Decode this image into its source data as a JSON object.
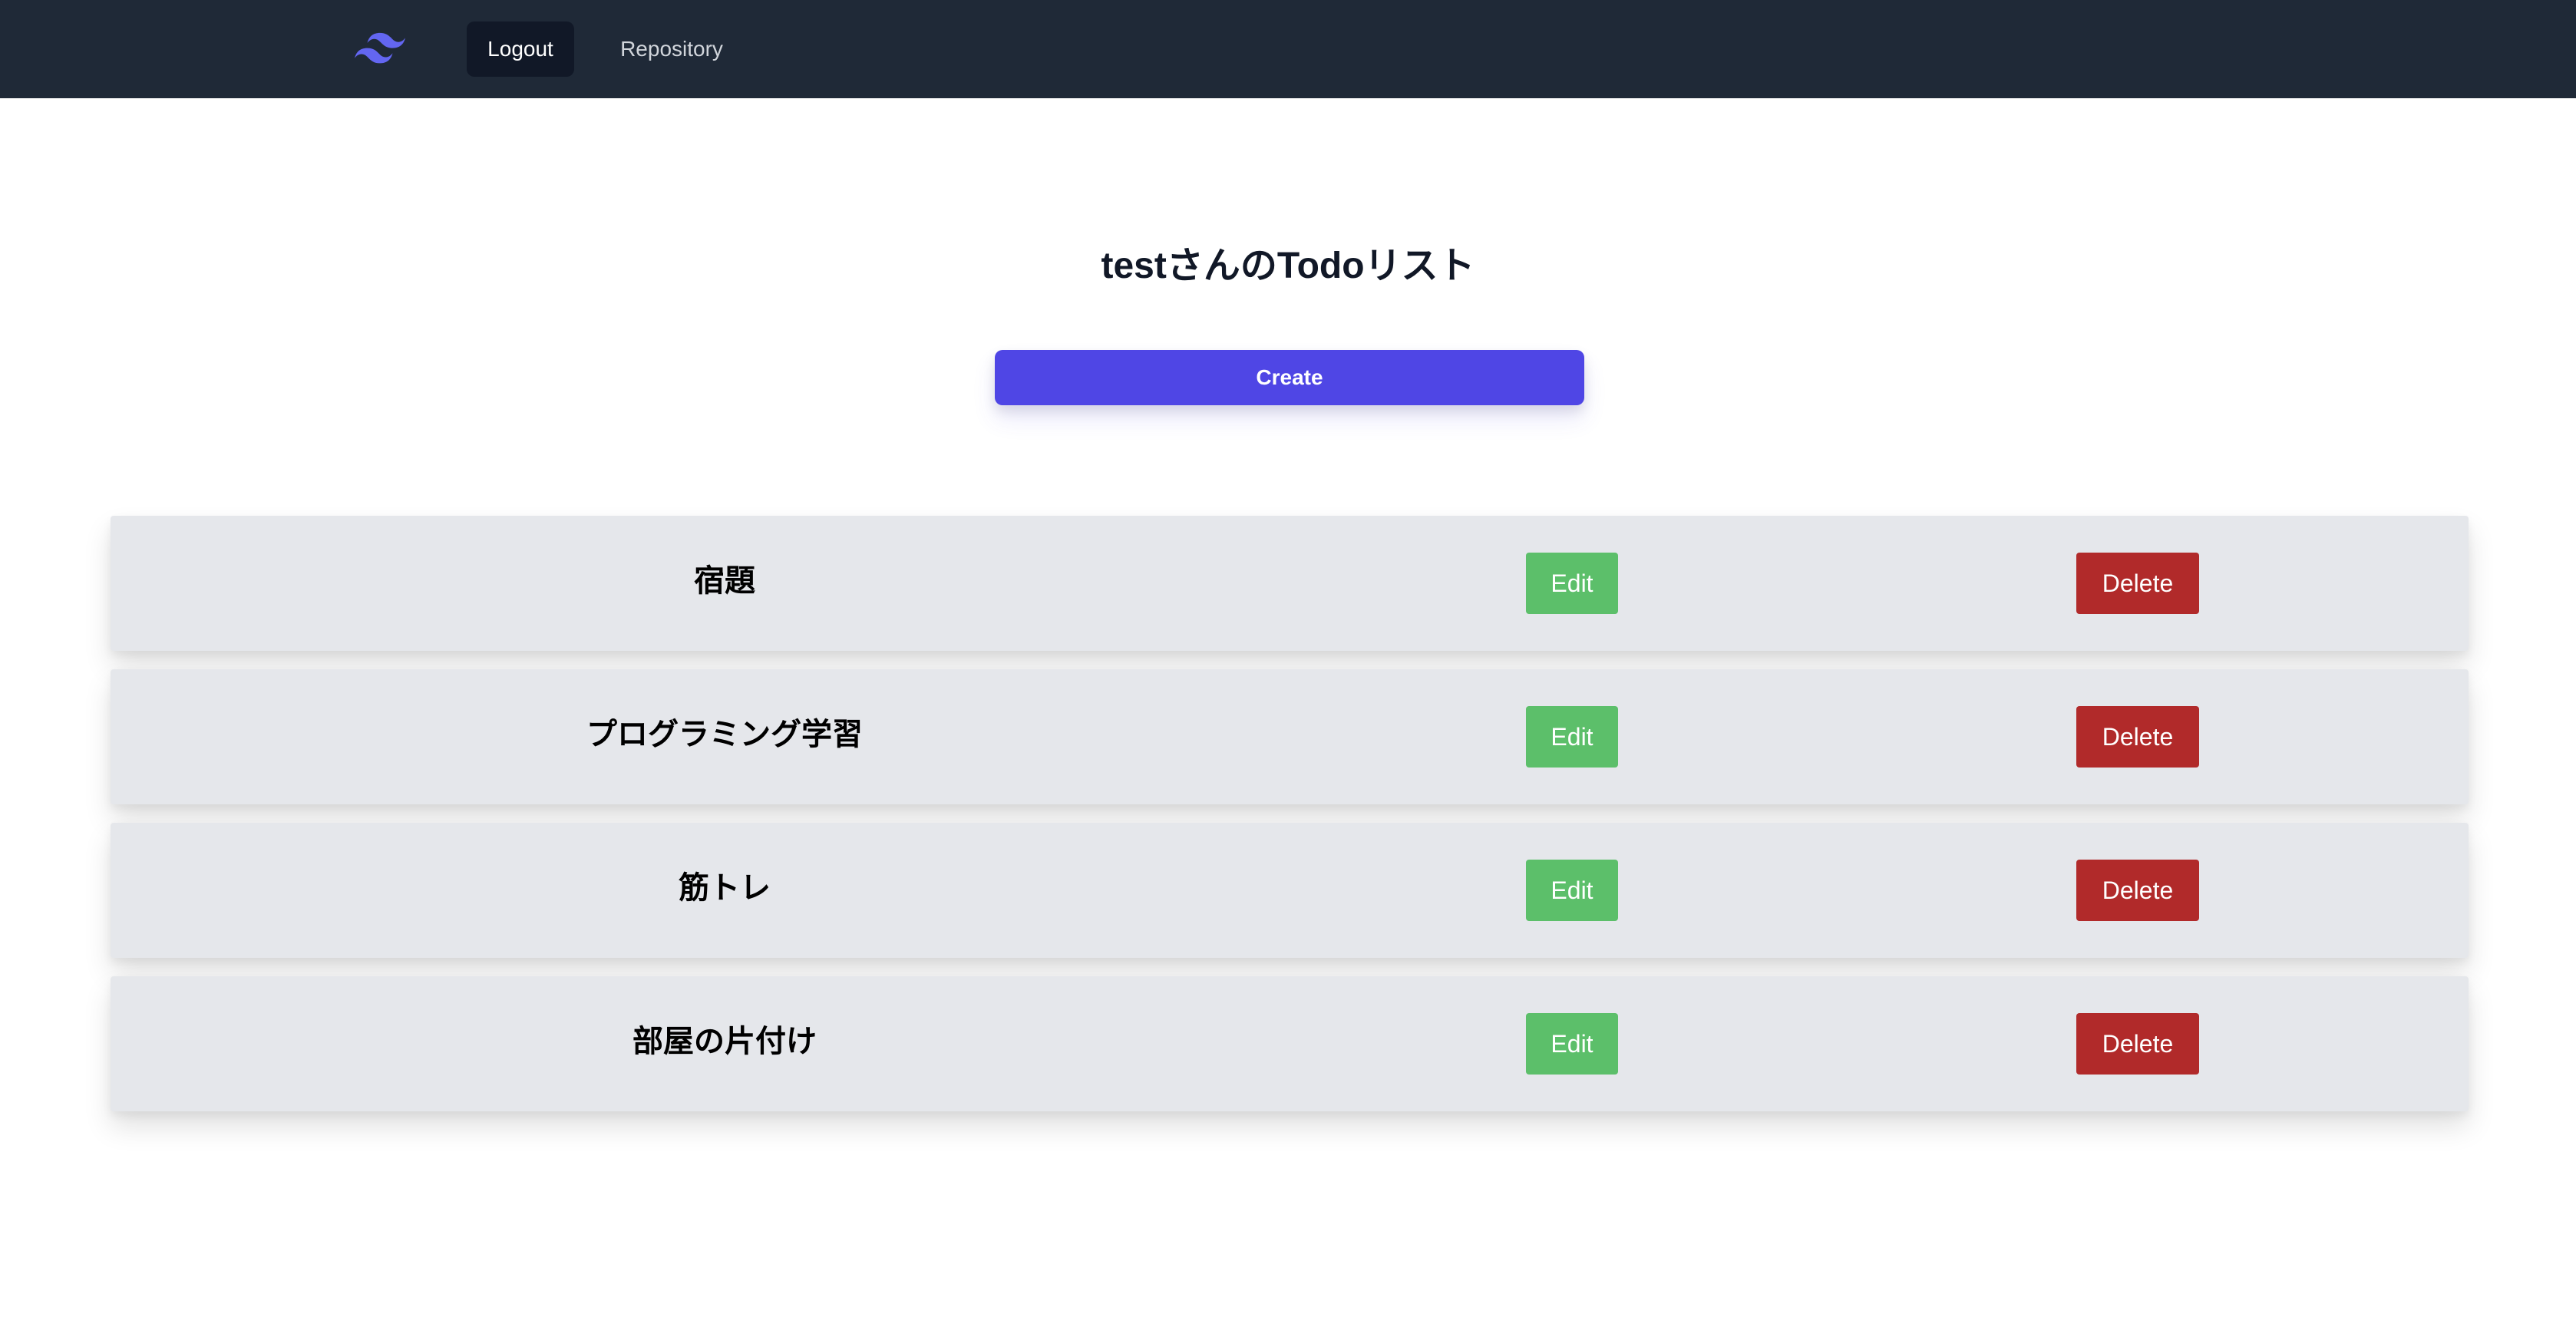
{
  "nav": {
    "logo_icon": "tailwind-wave-icon",
    "logout_label": "Logout",
    "repository_label": "Repository"
  },
  "page": {
    "title": "testさんのTodoリスト",
    "create_label": "Create"
  },
  "todos": [
    {
      "title": "宿題",
      "edit_label": "Edit",
      "delete_label": "Delete"
    },
    {
      "title": "プログラミング学習",
      "edit_label": "Edit",
      "delete_label": "Delete"
    },
    {
      "title": "筋トレ",
      "edit_label": "Edit",
      "delete_label": "Delete"
    },
    {
      "title": "部屋の片付け",
      "edit_label": "Edit",
      "delete_label": "Delete"
    }
  ],
  "colors": {
    "navbar": "#1f2937",
    "create": "#4f46e5",
    "edit": "#5cbf6a",
    "delete": "#b12a2a",
    "row": "#e5e7eb"
  }
}
